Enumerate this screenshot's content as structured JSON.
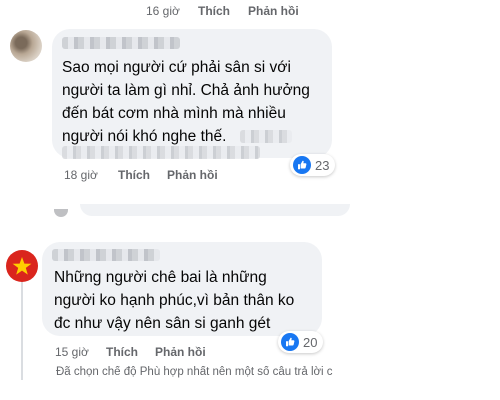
{
  "top_bar": {
    "time": "16 giờ",
    "like_label": "Thích",
    "reply_label": "Phản hồi"
  },
  "comments": [
    {
      "text_lines": [
        "Sao mọi người cứ phải sân si với",
        "người ta làm gì nhỉ. Chả ảnh hưởng",
        "đến bát cơm nhà mình mà nhiều",
        "người nói khó nghe thế."
      ],
      "reaction_count": "23",
      "time": "18 giờ",
      "like_label": "Thích",
      "reply_label": "Phản hồi"
    },
    {
      "text_lines": [
        "Những người chê bai là những",
        "người ko hạnh phúc,vì bản thân ko",
        "đc như vậy nên sân si ganh gét"
      ],
      "reaction_count": "20",
      "time": "15 giờ",
      "like_label": "Thích",
      "reply_label": "Phản hồi"
    }
  ],
  "footer_note": "Đã chọn chế độ Phù hợp nhất nên một số câu trả lời c",
  "colors": {
    "bubble": "#f0f2f5",
    "meta_text": "#65676b",
    "like_blue": "#1877f2",
    "flag_red": "#da251d",
    "flag_star": "#ffcd00"
  },
  "icons": {
    "like": "thumbs-up-icon",
    "avatar_flag": "vietnam-flag-avatar"
  }
}
